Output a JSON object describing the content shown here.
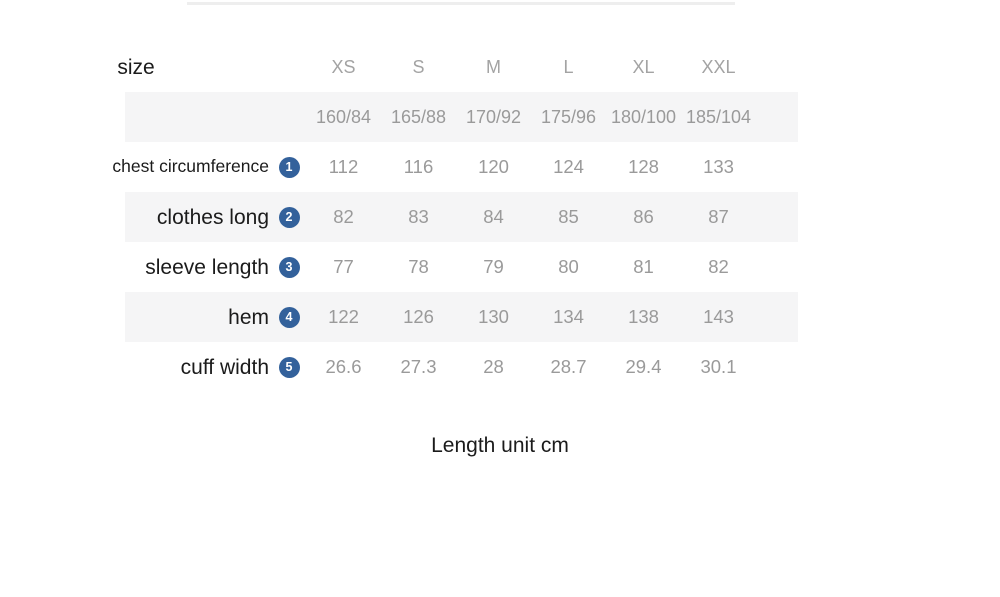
{
  "table": {
    "header": {
      "label": "size",
      "columns": [
        "XS",
        "S",
        "M",
        "L",
        "XL",
        "XXL"
      ]
    },
    "spec_row": {
      "label": "",
      "badge": "",
      "values": [
        "160/84",
        "165/88",
        "170/92",
        "175/96",
        "180/100",
        "185/104"
      ]
    },
    "rows": [
      {
        "label": "chest circumference",
        "badge": "1",
        "values": [
          "112",
          "116",
          "120",
          "124",
          "128",
          "133"
        ]
      },
      {
        "label": "clothes long",
        "badge": "2",
        "values": [
          "82",
          "83",
          "84",
          "85",
          "86",
          "87"
        ]
      },
      {
        "label": "sleeve length",
        "badge": "3",
        "values": [
          "77",
          "78",
          "79",
          "80",
          "81",
          "82"
        ]
      },
      {
        "label": "hem",
        "badge": "4",
        "values": [
          "122",
          "126",
          "130",
          "134",
          "138",
          "143"
        ]
      },
      {
        "label": "cuff width",
        "badge": "5",
        "values": [
          "26.6",
          "27.3",
          "28",
          "28.7",
          "29.4",
          "30.1"
        ]
      }
    ]
  },
  "footer": {
    "note": "Length unit cm"
  },
  "colors": {
    "badge_blue": "#33619b",
    "stripe_gray": "#f5f5f6",
    "value_gray": "#9a9a9a",
    "label_dark": "#1b1b1b"
  }
}
